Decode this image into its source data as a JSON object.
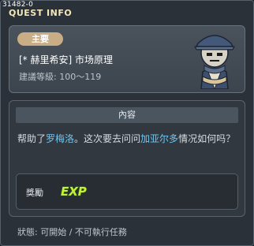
{
  "window": {
    "quest_id": "31482-0",
    "title": "QUEST INFO"
  },
  "quest": {
    "category": "主要",
    "name": "[* 赫里希安] 市场原理",
    "level_text": "建議等級: 100～119",
    "npc_icon": "npc-portrait-icon"
  },
  "content": {
    "header": "內容",
    "description_parts": {
      "p1": "帮助了",
      "npc1": "罗梅洛",
      "p2": "。这次要去问问",
      "npc2": "加亚尔多",
      "p3": "情况如何吗？"
    },
    "highlight_color": "#6fc6f2"
  },
  "reward": {
    "label": "獎勵",
    "exp_text": "EXP",
    "icon": "exp-icon"
  },
  "status": {
    "text": "狀態: 可開始 / 不可執行任務"
  }
}
